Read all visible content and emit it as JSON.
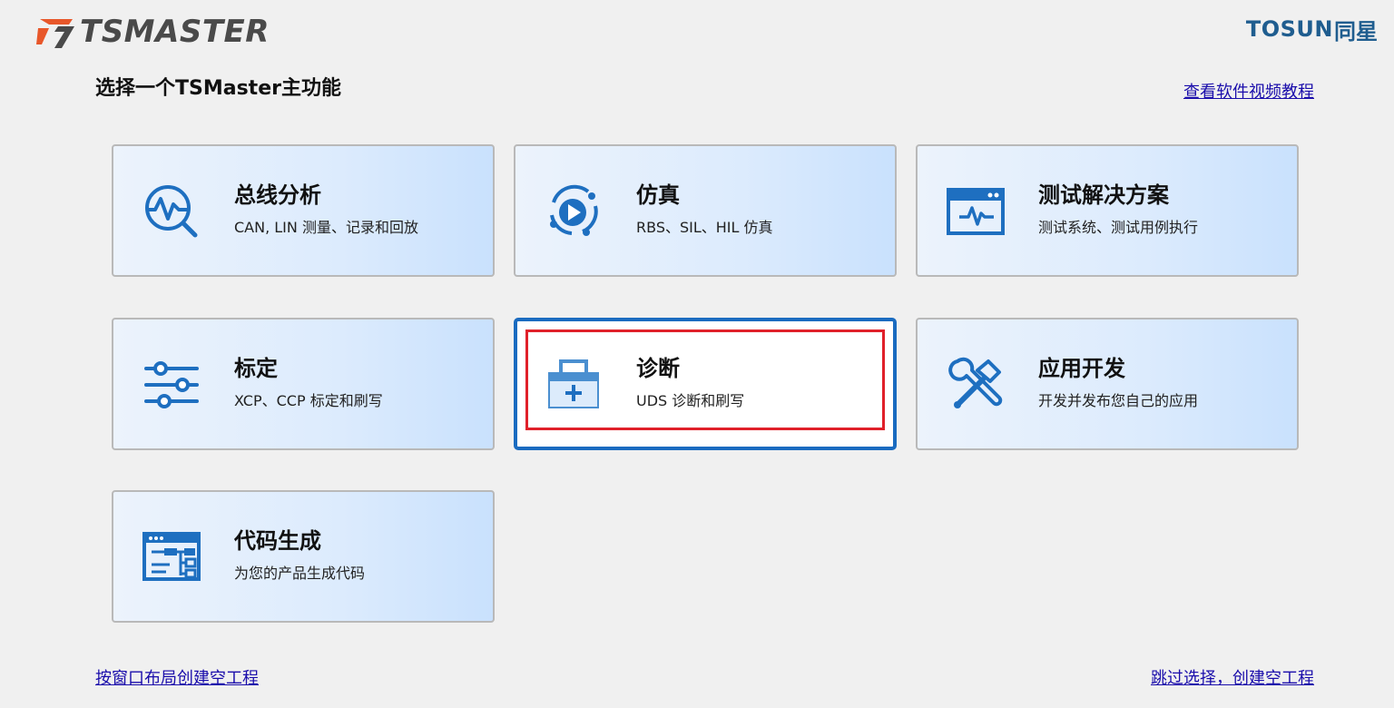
{
  "header": {
    "logo_text": "TSMASTER",
    "brand_logo_latin": "TOSUN",
    "brand_logo_cjk": "同星",
    "title": "选择一个TSMaster主功能",
    "tutorial_link": "查看软件视频教程"
  },
  "cards": [
    {
      "title": "总线分析",
      "subtitle": "CAN, LIN 测量、记录和回放",
      "icon": "bus-analysis-icon"
    },
    {
      "title": "仿真",
      "subtitle": "RBS、SIL、HIL 仿真",
      "icon": "simulation-play-icon"
    },
    {
      "title": "测试解决方案",
      "subtitle": "测试系统、测试用例执行",
      "icon": "test-window-icon"
    },
    {
      "title": "标定",
      "subtitle": "XCP、CCP 标定和刷写",
      "icon": "sliders-icon"
    },
    {
      "title": "诊断",
      "subtitle": "UDS 诊断和刷写",
      "icon": "medical-kit-icon",
      "selected": true
    },
    {
      "title": "应用开发",
      "subtitle": "开发并发布您自己的应用",
      "icon": "tools-icon"
    },
    {
      "title": "代码生成",
      "subtitle": "为您的产品生成代码",
      "icon": "code-generation-icon"
    }
  ],
  "footer": {
    "left_link": "按窗口布局创建空工程",
    "right_link": "跳过选择，创建空工程"
  },
  "colors": {
    "accent": "#1a6bc0",
    "icon_blue": "#1e6fc0",
    "focus_red": "#e0202a",
    "link": "#1a0dab"
  }
}
